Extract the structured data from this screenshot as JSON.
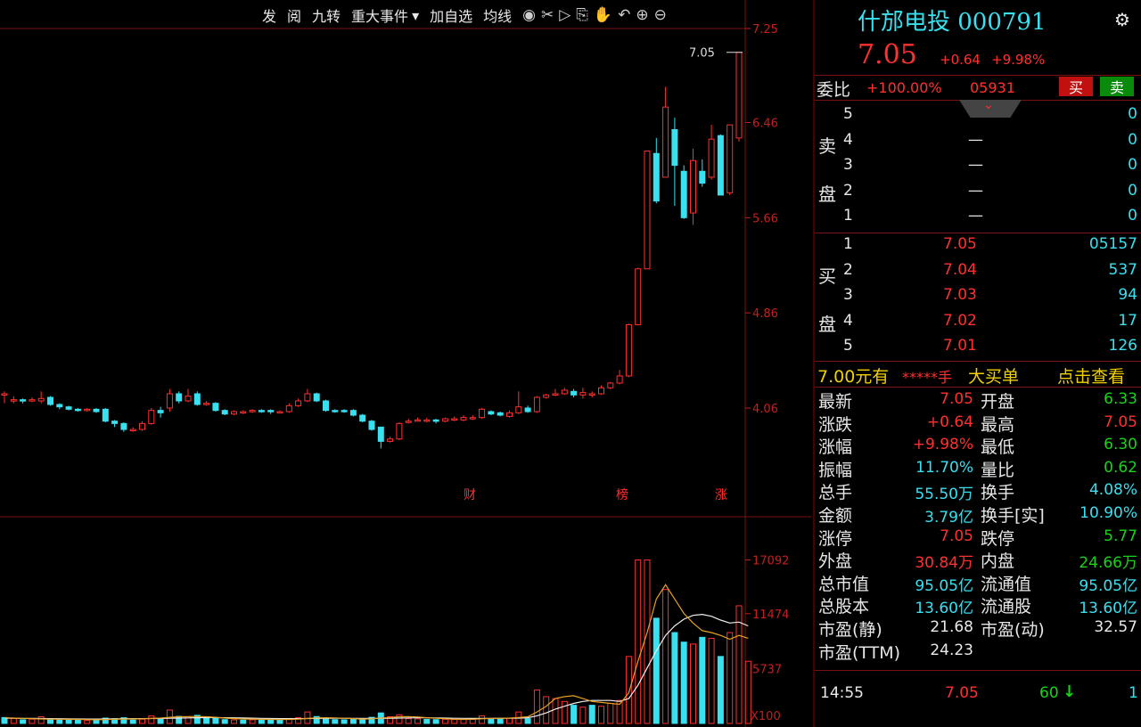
{
  "toolbar": {
    "items": [
      "发",
      "阅",
      "九转",
      "重大事件",
      "加自选",
      "均线"
    ],
    "dropdown_arrow": "▾",
    "icons": [
      "eye-icon",
      "scissors-icon",
      "play-icon",
      "copy-icon",
      "hand-icon",
      "undo-icon",
      "zoom-in-icon",
      "zoom-out-icon"
    ],
    "icon_glyphs": [
      "◉",
      "✂",
      "▷",
      "⎘",
      "✋",
      "↶",
      "⊕",
      "⊖"
    ]
  },
  "chart_data": [
    {
      "type": "candlestick",
      "price_ticks": [
        "7.25",
        "6.46",
        "5.66",
        "4.86",
        "4.06"
      ],
      "tick_values": [
        7.25,
        6.46,
        5.66,
        4.86,
        4.06
      ],
      "last_price_label": "7.05",
      "markers": [
        "财",
        "榜",
        "涨"
      ],
      "candles": [
        [
          4.17,
          4.18,
          4.1,
          4.2
        ],
        [
          4.12,
          4.13,
          4.1,
          4.16
        ],
        [
          4.13,
          4.12,
          4.1,
          4.14
        ],
        [
          4.12,
          4.13,
          4.11,
          4.15
        ],
        [
          4.12,
          4.14,
          4.1,
          4.2
        ],
        [
          4.15,
          4.09,
          4.08,
          4.16
        ],
        [
          4.09,
          4.07,
          4.05,
          4.1
        ],
        [
          4.07,
          4.05,
          4.04,
          4.08
        ],
        [
          4.05,
          4.04,
          4.03,
          4.06
        ],
        [
          4.04,
          4.05,
          4.03,
          4.06
        ],
        [
          4.05,
          4.03,
          4.02,
          4.06
        ],
        [
          4.05,
          3.95,
          3.94,
          4.06
        ],
        [
          3.95,
          3.93,
          3.9,
          3.96
        ],
        [
          3.93,
          3.88,
          3.86,
          3.94
        ],
        [
          3.88,
          3.88,
          3.86,
          3.9
        ],
        [
          3.88,
          3.93,
          3.87,
          3.95
        ],
        [
          3.93,
          4.04,
          3.92,
          4.06
        ],
        [
          4.04,
          4.02,
          3.98,
          4.07
        ],
        [
          4.06,
          4.18,
          4.03,
          4.22
        ],
        [
          4.18,
          4.12,
          4.1,
          4.2
        ],
        [
          4.12,
          4.16,
          4.11,
          4.22
        ],
        [
          4.18,
          4.09,
          4.08,
          4.2
        ],
        [
          4.1,
          4.1,
          4.08,
          4.12
        ],
        [
          4.1,
          4.04,
          4.03,
          4.11
        ],
        [
          4.04,
          4.01,
          4.0,
          4.05
        ],
        [
          4.01,
          4.03,
          4.0,
          4.04
        ],
        [
          4.03,
          4.03,
          4.01,
          4.04
        ],
        [
          4.03,
          4.04,
          4.02,
          4.05
        ],
        [
          4.04,
          4.03,
          4.02,
          4.05
        ],
        [
          4.04,
          4.03,
          4.01,
          4.05
        ],
        [
          4.03,
          4.03,
          4.02,
          4.04
        ],
        [
          4.03,
          4.08,
          4.02,
          4.1
        ],
        [
          4.08,
          4.12,
          4.07,
          4.14
        ],
        [
          4.12,
          4.18,
          4.11,
          4.22
        ],
        [
          4.18,
          4.12,
          4.11,
          4.19
        ],
        [
          4.12,
          4.04,
          4.03,
          4.13
        ],
        [
          4.04,
          4.03,
          4.02,
          4.05
        ],
        [
          4.04,
          4.03,
          4.02,
          4.05
        ],
        [
          4.04,
          4.0,
          3.99,
          4.05
        ],
        [
          4.0,
          3.95,
          3.94,
          4.01
        ],
        [
          3.95,
          3.88,
          3.87,
          3.96
        ],
        [
          3.9,
          3.78,
          3.72,
          3.9
        ],
        [
          3.78,
          3.8,
          3.77,
          3.82
        ],
        [
          3.8,
          3.93,
          3.79,
          3.94
        ],
        [
          3.94,
          3.95,
          3.93,
          3.97
        ],
        [
          3.96,
          3.96,
          3.95,
          3.98
        ],
        [
          3.96,
          3.96,
          3.94,
          3.98
        ],
        [
          3.96,
          3.95,
          3.93,
          3.97
        ],
        [
          3.95,
          3.97,
          3.94,
          3.98
        ],
        [
          3.96,
          3.97,
          3.95,
          3.99
        ],
        [
          3.96,
          3.98,
          3.95,
          4.0
        ],
        [
          3.98,
          3.98,
          3.96,
          4.0
        ],
        [
          3.98,
          4.05,
          3.97,
          4.06
        ],
        [
          4.03,
          4.01,
          4.0,
          4.04
        ],
        [
          4.02,
          4.0,
          3.99,
          4.03
        ],
        [
          3.99,
          4.02,
          3.98,
          4.04
        ],
        [
          4.02,
          4.07,
          4.01,
          4.2
        ],
        [
          4.06,
          4.03,
          4.02,
          4.08
        ],
        [
          4.03,
          4.15,
          4.02,
          4.16
        ],
        [
          4.15,
          4.17,
          4.14,
          4.18
        ],
        [
          4.17,
          4.18,
          4.16,
          4.22
        ],
        [
          4.18,
          4.21,
          4.17,
          4.23
        ],
        [
          4.2,
          4.17,
          4.15,
          4.22
        ],
        [
          4.17,
          4.19,
          4.14,
          4.23
        ],
        [
          4.18,
          4.18,
          4.15,
          4.2
        ],
        [
          4.18,
          4.23,
          4.17,
          4.25
        ],
        [
          4.23,
          4.27,
          4.22,
          4.28
        ],
        [
          4.27,
          4.33,
          4.26,
          4.38
        ],
        [
          4.33,
          4.76,
          4.32,
          4.77
        ],
        [
          4.76,
          5.23,
          4.91,
          5.24
        ],
        [
          5.23,
          6.22,
          5.23,
          6.22
        ],
        [
          6.2,
          5.8,
          5.78,
          6.33
        ],
        [
          6.0,
          6.59,
          6.0,
          6.76
        ],
        [
          6.4,
          6.1,
          5.76,
          6.5
        ],
        [
          6.05,
          5.66,
          5.65,
          6.1
        ],
        [
          5.7,
          6.14,
          5.6,
          6.24
        ],
        [
          6.05,
          5.95,
          5.92,
          6.15
        ],
        [
          6.0,
          6.32,
          5.98,
          6.44
        ],
        [
          6.35,
          5.85,
          5.85,
          6.36
        ],
        [
          5.87,
          6.44,
          5.85,
          6.44
        ],
        [
          6.33,
          7.05,
          6.3,
          7.05
        ]
      ]
    },
    {
      "type": "bar",
      "ticks": [
        "17092",
        "11474",
        "5737"
      ],
      "tick_values": [
        17092,
        11474,
        5737
      ],
      "unit_label": "X100",
      "ylim": [
        0,
        19000
      ],
      "volumes": [
        620,
        520,
        380,
        450,
        700,
        380,
        420,
        350,
        330,
        300,
        410,
        560,
        500,
        600,
        350,
        450,
        780,
        520,
        1400,
        740,
        700,
        850,
        520,
        520,
        400,
        370,
        340,
        380,
        400,
        380,
        360,
        480,
        600,
        1200,
        720,
        520,
        400,
        380,
        420,
        440,
        640,
        1100,
        700,
        900,
        500,
        480,
        420,
        400,
        440,
        420,
        410,
        420,
        800,
        460,
        450,
        560,
        1200,
        500,
        3500,
        2800,
        2600,
        2300,
        1900,
        1700,
        1900,
        1800,
        2100,
        2400,
        7000,
        17092,
        17092,
        11000,
        14000,
        9500,
        8500,
        8300,
        9000,
        8900,
        7000,
        9500,
        12300,
        6500
      ],
      "up": [
        0,
        1,
        0,
        1,
        1,
        0,
        0,
        0,
        0,
        1,
        0,
        0,
        0,
        0,
        0,
        1,
        1,
        0,
        1,
        0,
        1,
        0,
        0,
        0,
        0,
        1,
        0,
        1,
        0,
        0,
        0,
        1,
        1,
        1,
        0,
        0,
        0,
        0,
        0,
        0,
        0,
        0,
        1,
        1,
        1,
        1,
        0,
        0,
        1,
        1,
        1,
        1,
        1,
        0,
        0,
        1,
        1,
        0,
        1,
        1,
        1,
        1,
        0,
        1,
        0,
        1,
        1,
        1,
        1,
        1,
        1,
        0,
        1,
        0,
        0,
        1,
        0,
        1,
        0,
        1,
        1,
        1
      ],
      "ma_fast": [
        600,
        560,
        520,
        490,
        470,
        450,
        440,
        430,
        420,
        400,
        380,
        410,
        440,
        460,
        470,
        480,
        520,
        560,
        640,
        700,
        720,
        730,
        700,
        640,
        560,
        500,
        470,
        450,
        430,
        420,
        400,
        420,
        450,
        520,
        580,
        600,
        580,
        540,
        500,
        460,
        480,
        560,
        620,
        700,
        720,
        680,
        600,
        540,
        480,
        440,
        430,
        440,
        480,
        520,
        540,
        560,
        620,
        700,
        1200,
        1800,
        2600,
        2800,
        2900,
        2600,
        2300,
        2200,
        2100,
        2000,
        3200,
        6500,
        9500,
        13000,
        14500,
        13000,
        11500,
        10500,
        9700,
        9500,
        9200,
        8800,
        9200,
        8900
      ],
      "ma_slow": [
        550,
        540,
        530,
        520,
        510,
        500,
        490,
        480,
        470,
        460,
        460,
        470,
        480,
        490,
        500,
        500,
        510,
        520,
        540,
        560,
        580,
        600,
        610,
        610,
        600,
        590,
        570,
        550,
        530,
        510,
        500,
        500,
        500,
        510,
        520,
        530,
        540,
        540,
        530,
        520,
        520,
        530,
        540,
        560,
        580,
        590,
        590,
        580,
        560,
        540,
        530,
        520,
        520,
        530,
        540,
        550,
        560,
        600,
        800,
        1100,
        1500,
        1800,
        2100,
        2300,
        2400,
        2400,
        2400,
        2300,
        2600,
        4000,
        5800,
        7600,
        9200,
        10200,
        10900,
        11300,
        11400,
        11200,
        10800,
        10500,
        10600,
        10200
      ]
    }
  ],
  "panel": {
    "title": "什邡电投 000791",
    "price": "7.05",
    "change": "+0.64",
    "change_pct": "+9.98%",
    "weibi_label": "委比",
    "weibi_pct": "+100.00%",
    "weibi_diff": "05931",
    "buy_btn": "买",
    "sell_btn": "卖",
    "sell_side_label": [
      "卖",
      "盘"
    ],
    "buy_side_label": [
      "买",
      "盘"
    ],
    "sell_rows": [
      {
        "level": "5",
        "price": "",
        "vol": "0"
      },
      {
        "level": "4",
        "price": "—",
        "vol": "0"
      },
      {
        "level": "3",
        "price": "—",
        "vol": "0"
      },
      {
        "level": "2",
        "price": "—",
        "vol": "0"
      },
      {
        "level": "1",
        "price": "—",
        "vol": "0"
      }
    ],
    "buy_rows": [
      {
        "level": "1",
        "price": "7.05",
        "vol": "05157"
      },
      {
        "level": "2",
        "price": "7.04",
        "vol": "537"
      },
      {
        "level": "3",
        "price": "7.03",
        "vol": "94"
      },
      {
        "level": "4",
        "price": "7.02",
        "vol": "17"
      },
      {
        "level": "5",
        "price": "7.01",
        "vol": "126"
      }
    ],
    "big_order": {
      "price_text": "7.00元有",
      "mask": "*****手",
      "label": "大买单",
      "link": "点击查看"
    },
    "stats": [
      {
        "l1": "最新",
        "v1": "7.05",
        "c1": "red",
        "l2": "开盘",
        "v2": "6.33",
        "c2": "green"
      },
      {
        "l1": "涨跌",
        "v1": "+0.64",
        "c1": "red",
        "l2": "最高",
        "v2": "7.05",
        "c2": "red"
      },
      {
        "l1": "涨幅",
        "v1": "+9.98%",
        "c1": "red",
        "l2": "最低",
        "v2": "6.30",
        "c2": "green"
      },
      {
        "l1": "振幅",
        "v1": "11.70%",
        "c1": "cyan",
        "l2": "量比",
        "v2": "0.62",
        "c2": "green"
      },
      {
        "l1": "总手",
        "v1": "55.50万",
        "c1": "cyan",
        "l2": "换手",
        "v2": "4.08%",
        "c2": "cyan"
      },
      {
        "l1": "金额",
        "v1": "3.79亿",
        "c1": "cyan",
        "l2": "换手[实]",
        "v2": "10.90%",
        "c2": "cyan"
      },
      {
        "l1": "涨停",
        "v1": "7.05",
        "c1": "red",
        "l2": "跌停",
        "v2": "5.77",
        "c2": "green"
      },
      {
        "l1": "外盘",
        "v1": "30.84万",
        "c1": "red",
        "l2": "内盘",
        "v2": "24.66万",
        "c2": "green"
      },
      {
        "l1": "总市值",
        "v1": "95.05亿",
        "c1": "cyan",
        "l2": "流通值",
        "v2": "95.05亿",
        "c2": "cyan"
      },
      {
        "l1": "总股本",
        "v1": "13.60亿",
        "c1": "cyan",
        "l2": "流通股",
        "v2": "13.60亿",
        "c2": "cyan"
      },
      {
        "l1": "市盈(静)",
        "v1": "21.68",
        "c1": "white",
        "l2": "市盈(动)",
        "v2": "32.57",
        "c2": "white"
      },
      {
        "l1": "市盈(TTM)",
        "v1": "24.23",
        "c1": "white",
        "l2": "",
        "v2": "",
        "c2": "white"
      }
    ],
    "tick": {
      "time": "14:55",
      "price": "7.05",
      "vol": "60",
      "dir_icon": "↓",
      "count": "1"
    },
    "colors": {
      "up": "#ff3030",
      "down": "#38e0f0",
      "ma_fast": "#e8a020",
      "ma_slow": "#f0f0f0",
      "grid": "#7a1010"
    }
  }
}
